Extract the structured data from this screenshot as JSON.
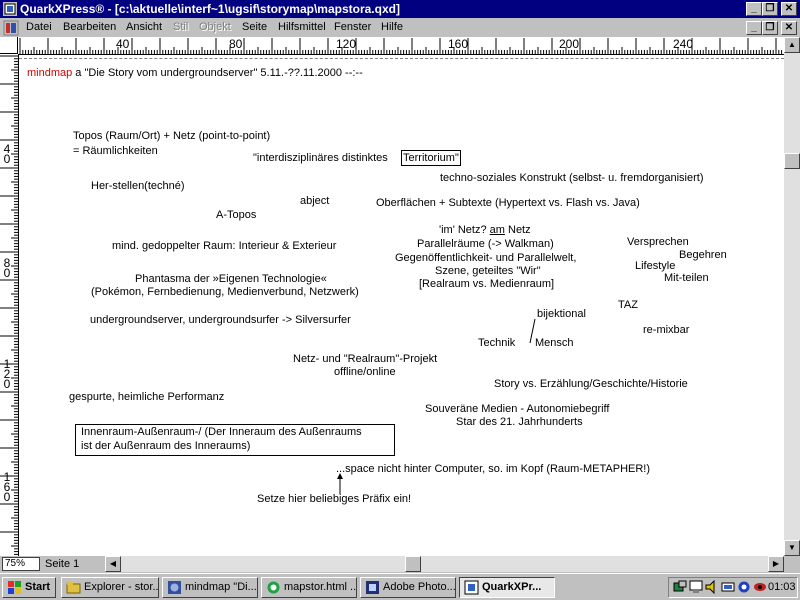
{
  "window": {
    "title": "QuarkXPress® - [c:\\aktuelle\\interf~1\\ugsif\\storymap\\mapstora.qxd]",
    "minimize": "_",
    "restore": "❐",
    "close": "✕"
  },
  "menu": [
    "Datei",
    "Bearbeiten",
    "Ansicht",
    "Stil",
    "Objekt",
    "Seite",
    "Hilfsmittel",
    "Fenster",
    "Hilfe"
  ],
  "ruler": {
    "h_labels": [
      "40",
      "80",
      "120",
      "160",
      "200",
      "240"
    ],
    "v_labels": [
      "4\n0",
      "8\n0",
      "1\n2\n0",
      "1\n6\n0"
    ]
  },
  "doc": {
    "header_mindmap": "mindmap",
    "header_rest": " a \"Die Story vom undergroundserver\" 5.11.-??.11.2000 --:--",
    "topos1": "Topos (Raum/Ort) + Netz (point-to-point)",
    "topos2": "= Räumlichkeiten",
    "interdiszip": "\"interdisziplinäres distinktes",
    "territorium": "Territorium\"",
    "herstellen": "Her-stellen(techné)",
    "techno": "techno-soziales Konstrukt (selbst- u. fremdorganisiert)",
    "abject": "abject",
    "oberflaechen": "Oberflächen + Subtexte (Hypertext vs. Flash vs. Java)",
    "atopos": "A-Topos",
    "imnetz_a": "'im' Netz? ",
    "imnetz_b": "am",
    "imnetz_c": " Netz",
    "mind_gedoppelt": "mind. gedoppelter Raum: Interieur & Exterieur",
    "parallel1": "Parallelräume (-> Walkman)",
    "parallel2": "Gegenöffentlichkeit- und Parallelwelt,",
    "parallel3": "Szene, geteiltes \"Wir\"",
    "parallel4": "[Realraum vs. Medienraum]",
    "versprechen": "Versprechen",
    "begehren": "Begehren",
    "lifestyle": "Lifestyle",
    "mitteilen": "Mit-teilen",
    "phantasma1": "Phantasma der »Eigenen Technologie«",
    "phantasma2": "(Pokémon, Fernbedienung, Medienverbund, Netzwerk)",
    "taz": "TAZ",
    "bijektional": "bijektional",
    "undergroundserver": "undergroundserver, undergroundsurfer -> Silversurfer",
    "remixbar": "re-mixbar",
    "technik": "Technik",
    "mensch": "Mensch",
    "netz_real": "Netz- und \"Realraum\"-Projekt",
    "offline_online": "offline/online",
    "story": "Story vs. Erzählung/Geschichte/Historie",
    "performanz": "gespurte, heimliche Performanz",
    "souveraene": "Souveräne Medien - Autonomiebegriff",
    "star": "Star des 21. Jahrhunderts",
    "innenraum1": "Innenraum-Außenraum-/ (Der Inneraum des Außenraums",
    "innenraum2": "ist der Außenraum des Inneraums)",
    "space": "...space nicht hinter Computer, so. im Kopf (Raum-METAPHER!)",
    "setze": "Setze hier beliebiges Präfix ein!"
  },
  "status": {
    "zoom": "75%",
    "page": "Seite 1"
  },
  "taskbar": {
    "start": "Start",
    "tasks": [
      "Explorer - stor...",
      "mindmap \"Di...",
      "mapstor.html ...",
      "Adobe Photo...",
      "QuarkXPr..."
    ],
    "clock": "01:03"
  },
  "colors": {
    "titlebar": "#000080",
    "mindmap_red": "#d40000"
  }
}
